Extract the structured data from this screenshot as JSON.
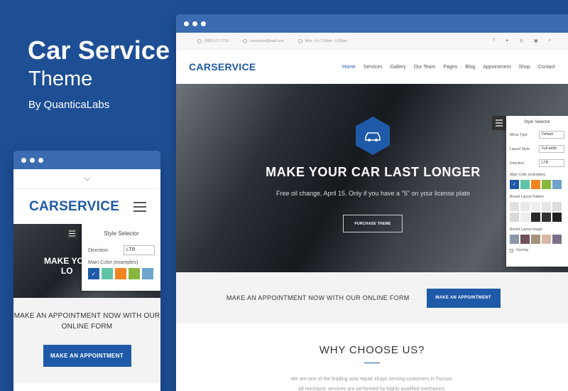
{
  "promo": {
    "title": "Car Service",
    "subtitle": "Theme",
    "byline": "By QuanticaLabs"
  },
  "mobile": {
    "logo": "CARSERVICE",
    "hero_text_line1": "MAKE YOU",
    "hero_text_line2": "LO",
    "style_selector": {
      "title": "Style Selector",
      "direction_label": "Direction:",
      "direction_value": "LTR",
      "main_color_label": "Main Color (examples)"
    },
    "appointment_text": "MAKE AN APPOINTMENT NOW WITH OUR ONLINE FORM",
    "appointment_button": "MAKE AN APPOINTMENT"
  },
  "desktop": {
    "topbar": {
      "phone": "(589) 577 2710",
      "email": "carservice@mail.com",
      "hours": "Mon - Fri 7:30am - 5:30pm"
    },
    "logo": "CARSERVICE",
    "menu": [
      "Home",
      "Services",
      "Gallery",
      "Our Team",
      "Pages",
      "Blog",
      "Appointment",
      "Shop",
      "Contact"
    ],
    "hero": {
      "title": "MAKE YOUR CAR LAST LONGER",
      "subtitle": "Free oil change, April 15. Only if you have a \"5\" on your license plate",
      "button": "PURCHASE THEME"
    },
    "style_selector": {
      "title": "Style Selector",
      "menu_type_label": "Menu Type:",
      "menu_type_value": "Default",
      "layout_style_label": "Layout Style:",
      "layout_style_value": "Full width",
      "direction_label": "Direction:",
      "direction_value": "LTR",
      "main_color_label": "Main Color (examples)",
      "boxed_pattern_label": "Boxed Layout Pattern",
      "boxed_image_label": "Boxed Layout Image",
      "overlay_label": "Overlay"
    },
    "appointment_text": "MAKE AN APPOINTMENT NOW WITH OUR ONLINE FORM",
    "appointment_button": "MAKE AN APPOINTMENT",
    "why": {
      "title": "WHY CHOOSE US?",
      "line1": "We are one of the leading auto repair shops serving customers in Tucson.",
      "line2": "All mechanic services are performed by highly qualified mechanics."
    }
  },
  "colors": {
    "background": "#1e4f95",
    "brand_blue": "#1e5aa8",
    "swatches": [
      "#1e5aa8",
      "#5fc3a5",
      "#f08421",
      "#86b73c",
      "#6ea4cc"
    ]
  }
}
